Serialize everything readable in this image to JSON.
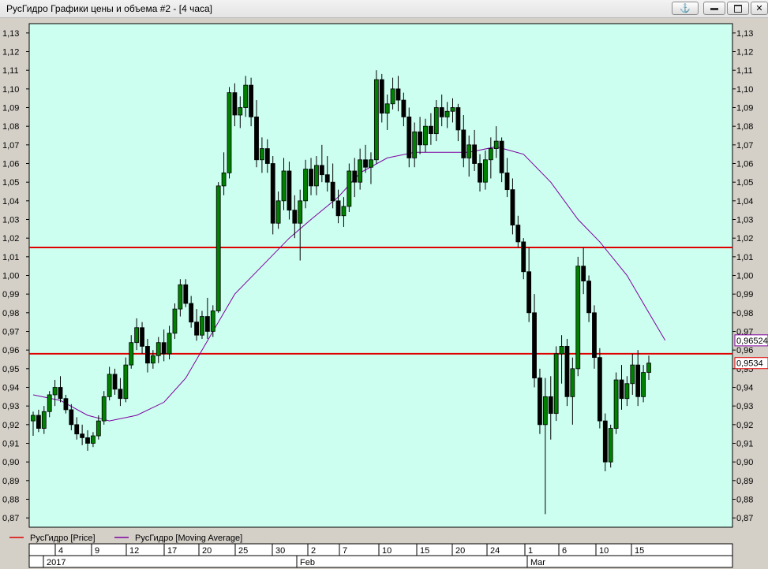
{
  "window": {
    "title": "РусГидро Графики цены и объема #2 - [4 часа]",
    "anchor_icon": "anchor-icon",
    "buttons": [
      "minimize-icon",
      "restore-icon",
      "close-icon"
    ]
  },
  "colors": {
    "plot_bg": "#ccfff0",
    "frame_bg": "#d4d0c8",
    "price_line": "#e00000",
    "ma_line": "#8000a0",
    "candle": "#000000"
  },
  "chart_data": {
    "type": "candlestick",
    "title": "",
    "ylim": [
      0.865,
      1.135
    ],
    "y_ticks": [
      "1,13",
      "1,12",
      "1,11",
      "1,10",
      "1,09",
      "1,08",
      "1,07",
      "1,06",
      "1,05",
      "1,04",
      "1,03",
      "1,02",
      "1,01",
      "1,00",
      "0,99",
      "0,98",
      "0,97",
      "0,96",
      "0,95",
      "0,94",
      "0,93",
      "0,92",
      "0,91",
      "0,90",
      "0,89",
      "0,88",
      "0,87"
    ],
    "x_day_ticks": [
      "4",
      "9",
      "12",
      "17",
      "20",
      "25",
      "30",
      "2",
      "7",
      "10",
      "15",
      "20",
      "24",
      "1",
      "6",
      "10",
      "15"
    ],
    "x_month_labels": [
      "2017",
      "Feb",
      "Mar"
    ],
    "horizontal_lines": [
      1.015,
      0.958
    ],
    "value_labels": {
      "ma_last": "0,96524",
      "price_last": "0,9534"
    },
    "legend": [
      {
        "name": "РусГидро [Price]",
        "color": "#e00000"
      },
      {
        "name": "РусГидро [Moving Average]",
        "color": "#8000a0"
      }
    ],
    "candles": [
      [
        0.922,
        0.927,
        0.914,
        0.925
      ],
      [
        0.925,
        0.928,
        0.916,
        0.918
      ],
      [
        0.918,
        0.93,
        0.915,
        0.927
      ],
      [
        0.927,
        0.938,
        0.924,
        0.936
      ],
      [
        0.936,
        0.944,
        0.93,
        0.94
      ],
      [
        0.94,
        0.946,
        0.932,
        0.934
      ],
      [
        0.934,
        0.936,
        0.926,
        0.928
      ],
      [
        0.928,
        0.931,
        0.917,
        0.92
      ],
      [
        0.92,
        0.924,
        0.912,
        0.915
      ],
      [
        0.915,
        0.92,
        0.909,
        0.913
      ],
      [
        0.913,
        0.917,
        0.906,
        0.91
      ],
      [
        0.91,
        0.916,
        0.908,
        0.914
      ],
      [
        0.914,
        0.925,
        0.912,
        0.922
      ],
      [
        0.922,
        0.938,
        0.92,
        0.935
      ],
      [
        0.935,
        0.951,
        0.933,
        0.947
      ],
      [
        0.947,
        0.95,
        0.936,
        0.939
      ],
      [
        0.939,
        0.945,
        0.93,
        0.934
      ],
      [
        0.934,
        0.956,
        0.932,
        0.952
      ],
      [
        0.952,
        0.968,
        0.95,
        0.964
      ],
      [
        0.964,
        0.977,
        0.96,
        0.972
      ],
      [
        0.972,
        0.975,
        0.958,
        0.962
      ],
      [
        0.962,
        0.966,
        0.948,
        0.953
      ],
      [
        0.953,
        0.96,
        0.95,
        0.957
      ],
      [
        0.957,
        0.967,
        0.953,
        0.964
      ],
      [
        0.964,
        0.971,
        0.954,
        0.958
      ],
      [
        0.958,
        0.973,
        0.955,
        0.969
      ],
      [
        0.969,
        0.985,
        0.966,
        0.982
      ],
      [
        0.982,
        0.998,
        0.978,
        0.995
      ],
      [
        0.995,
        0.998,
        0.983,
        0.985
      ],
      [
        0.985,
        0.989,
        0.972,
        0.975
      ],
      [
        0.975,
        0.982,
        0.965,
        0.968
      ],
      [
        0.968,
        0.981,
        0.966,
        0.978
      ],
      [
        0.978,
        0.988,
        0.966,
        0.97
      ],
      [
        0.97,
        0.984,
        0.967,
        0.981
      ],
      [
        0.981,
        1.05,
        0.98,
        1.048
      ],
      [
        1.048,
        1.066,
        1.043,
        1.055
      ],
      [
        1.055,
        1.101,
        1.052,
        1.098
      ],
      [
        1.098,
        1.103,
        1.08,
        1.086
      ],
      [
        1.086,
        1.096,
        1.079,
        1.09
      ],
      [
        1.09,
        1.107,
        1.085,
        1.102
      ],
      [
        1.102,
        1.106,
        1.08,
        1.085
      ],
      [
        1.085,
        1.094,
        1.058,
        1.062
      ],
      [
        1.062,
        1.074,
        1.055,
        1.068
      ],
      [
        1.068,
        1.073,
        1.055,
        1.06
      ],
      [
        1.06,
        1.064,
        1.022,
        1.028
      ],
      [
        1.028,
        1.045,
        1.025,
        1.04
      ],
      [
        1.04,
        1.063,
        1.035,
        1.056
      ],
      [
        1.056,
        1.061,
        1.03,
        1.035
      ],
      [
        1.035,
        1.043,
        1.02,
        1.028
      ],
      [
        1.028,
        1.046,
        1.008,
        1.04
      ],
      [
        1.04,
        1.062,
        1.036,
        1.057
      ],
      [
        1.057,
        1.063,
        1.043,
        1.048
      ],
      [
        1.048,
        1.064,
        1.043,
        1.059
      ],
      [
        1.059,
        1.07,
        1.05,
        1.054
      ],
      [
        1.054,
        1.064,
        1.045,
        1.05
      ],
      [
        1.05,
        1.06,
        1.036,
        1.04
      ],
      [
        1.04,
        1.046,
        1.028,
        1.032
      ],
      [
        1.032,
        1.042,
        1.026,
        1.037
      ],
      [
        1.037,
        1.06,
        1.034,
        1.056
      ],
      [
        1.056,
        1.063,
        1.042,
        1.05
      ],
      [
        1.05,
        1.068,
        1.046,
        1.062
      ],
      [
        1.062,
        1.07,
        1.055,
        1.058
      ],
      [
        1.058,
        1.066,
        1.049,
        1.062
      ],
      [
        1.062,
        1.11,
        1.06,
        1.105
      ],
      [
        1.105,
        1.108,
        1.082,
        1.087
      ],
      [
        1.087,
        1.097,
        1.078,
        1.092
      ],
      [
        1.092,
        1.106,
        1.089,
        1.1
      ],
      [
        1.1,
        1.107,
        1.088,
        1.094
      ],
      [
        1.094,
        1.098,
        1.08,
        1.085
      ],
      [
        1.085,
        1.09,
        1.058,
        1.063
      ],
      [
        1.063,
        1.082,
        1.058,
        1.077
      ],
      [
        1.077,
        1.085,
        1.065,
        1.07
      ],
      [
        1.07,
        1.084,
        1.066,
        1.08
      ],
      [
        1.08,
        1.087,
        1.07,
        1.076
      ],
      [
        1.076,
        1.094,
        1.072,
        1.09
      ],
      [
        1.09,
        1.097,
        1.08,
        1.085
      ],
      [
        1.085,
        1.093,
        1.079,
        1.088
      ],
      [
        1.088,
        1.095,
        1.082,
        1.09
      ],
      [
        1.09,
        1.092,
        1.072,
        1.078
      ],
      [
        1.078,
        1.086,
        1.058,
        1.063
      ],
      [
        1.063,
        1.075,
        1.053,
        1.07
      ],
      [
        1.07,
        1.078,
        1.056,
        1.06
      ],
      [
        1.06,
        1.065,
        1.045,
        1.05
      ],
      [
        1.05,
        1.067,
        1.046,
        1.062
      ],
      [
        1.062,
        1.074,
        1.052,
        1.068
      ],
      [
        1.068,
        1.08,
        1.063,
        1.072
      ],
      [
        1.072,
        1.074,
        1.05,
        1.055
      ],
      [
        1.055,
        1.063,
        1.042,
        1.046
      ],
      [
        1.046,
        1.052,
        1.022,
        1.027
      ],
      [
        1.027,
        1.032,
        1.015,
        1.018
      ],
      [
        1.018,
        1.02,
        0.998,
        1.002
      ],
      [
        1.002,
        1.015,
        0.975,
        0.98
      ],
      [
        0.98,
        0.99,
        0.94,
        0.945
      ],
      [
        0.945,
        0.95,
        0.915,
        0.92
      ],
      [
        0.92,
        0.945,
        0.872,
        0.935
      ],
      [
        0.935,
        0.946,
        0.912,
        0.926
      ],
      [
        0.926,
        0.962,
        0.922,
        0.958
      ],
      [
        0.958,
        0.968,
        0.942,
        0.962
      ],
      [
        0.962,
        0.966,
        0.93,
        0.935
      ],
      [
        0.935,
        0.956,
        0.92,
        0.95
      ],
      [
        0.95,
        1.01,
        0.946,
        1.005
      ],
      [
        1.005,
        1.015,
        0.99,
        0.997
      ],
      [
        0.997,
        1.0,
        0.975,
        0.98
      ],
      [
        0.98,
        0.984,
        0.95,
        0.956
      ],
      [
        0.956,
        0.961,
        0.918,
        0.922
      ],
      [
        0.922,
        0.926,
        0.895,
        0.9
      ],
      [
        0.9,
        0.92,
        0.897,
        0.918
      ],
      [
        0.918,
        0.948,
        0.915,
        0.944
      ],
      [
        0.944,
        0.952,
        0.928,
        0.934
      ],
      [
        0.934,
        0.946,
        0.93,
        0.942
      ],
      [
        0.942,
        0.958,
        0.936,
        0.952
      ],
      [
        0.952,
        0.96,
        0.93,
        0.935
      ],
      [
        0.935,
        0.952,
        0.932,
        0.948
      ],
      [
        0.948,
        0.957,
        0.944,
        0.953
      ]
    ],
    "moving_average": [
      [
        0,
        0.936
      ],
      [
        5,
        0.933
      ],
      [
        10,
        0.925
      ],
      [
        14,
        0.922
      ],
      [
        19,
        0.925
      ],
      [
        24,
        0.932
      ],
      [
        28,
        0.945
      ],
      [
        33,
        0.97
      ],
      [
        37,
        0.99
      ],
      [
        42,
        1.005
      ],
      [
        47,
        1.02
      ],
      [
        51,
        1.03
      ],
      [
        56,
        1.042
      ],
      [
        60,
        1.055
      ],
      [
        65,
        1.063
      ],
      [
        70,
        1.066
      ],
      [
        75,
        1.066
      ],
      [
        80,
        1.066
      ],
      [
        85,
        1.069
      ],
      [
        90,
        1.065
      ],
      [
        95,
        1.05
      ],
      [
        100,
        1.03
      ],
      [
        104,
        1.018
      ],
      [
        109,
        1.0
      ],
      [
        113,
        0.98
      ],
      [
        116,
        0.9652
      ]
    ]
  },
  "legend_labels": {
    "price": "РусГидро [Price]",
    "ma": "РусГидро [Moving Average]"
  }
}
